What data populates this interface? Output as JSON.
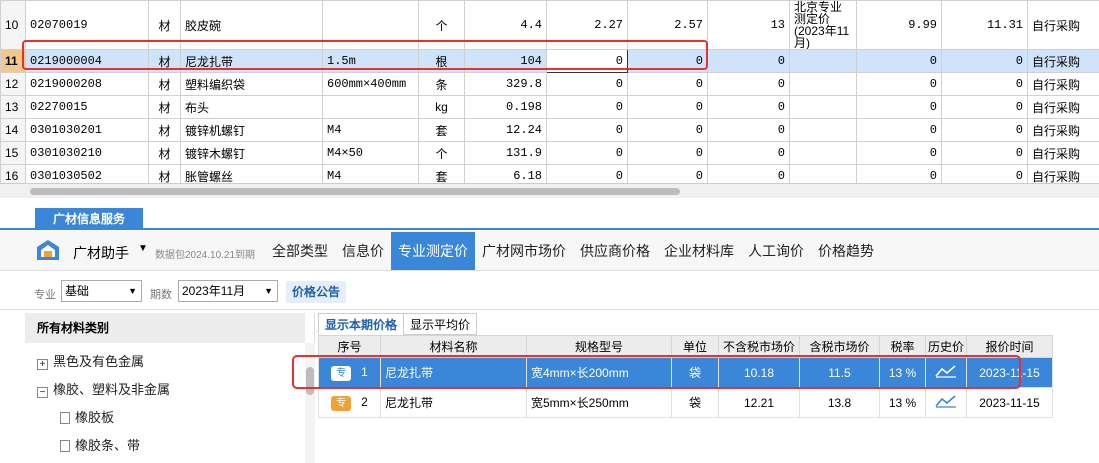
{
  "top_rows": [
    {
      "row": "10",
      "code": "02070019",
      "type": "材",
      "name": "胶皮碗",
      "spec": "",
      "unit": "个",
      "qty": "4.4",
      "p1": "2.27",
      "p2": "2.57",
      "p3": "13",
      "note": "北京专业测定价(2023年11月)",
      "p4": "9.99",
      "p5": "11.31",
      "source": "自行采购"
    },
    {
      "row": "11",
      "code": "0219000004",
      "type": "材",
      "name": "尼龙扎带",
      "spec": "1.5m",
      "unit": "根",
      "qty": "104",
      "p1": "0",
      "p2": "0",
      "p3": "0",
      "note": "",
      "p4": "0",
      "p5": "0",
      "source": "自行采购"
    },
    {
      "row": "12",
      "code": "0219000208",
      "type": "材",
      "name": "塑料编织袋",
      "spec": "600mm×400mm",
      "unit": "条",
      "qty": "329.8",
      "p1": "0",
      "p2": "0",
      "p3": "0",
      "note": "",
      "p4": "0",
      "p5": "0",
      "source": "自行采购"
    },
    {
      "row": "13",
      "code": "02270015",
      "type": "材",
      "name": "布头",
      "spec": "",
      "unit": "kg",
      "qty": "0.198",
      "p1": "0",
      "p2": "0",
      "p3": "0",
      "note": "",
      "p4": "0",
      "p5": "0",
      "source": "自行采购"
    },
    {
      "row": "14",
      "code": "0301030201",
      "type": "材",
      "name": "镀锌机螺钉",
      "spec": "M4",
      "unit": "套",
      "qty": "12.24",
      "p1": "0",
      "p2": "0",
      "p3": "0",
      "note": "",
      "p4": "0",
      "p5": "0",
      "source": "自行采购"
    },
    {
      "row": "15",
      "code": "0301030210",
      "type": "材",
      "name": "镀锌木螺钉",
      "spec": "M4×50",
      "unit": "个",
      "qty": "131.9",
      "p1": "0",
      "p2": "0",
      "p3": "0",
      "note": "",
      "p4": "0",
      "p5": "0",
      "source": "自行采购"
    },
    {
      "row": "16",
      "code": "0301030502",
      "type": "材",
      "name": "胀管螺丝",
      "spec": "M4",
      "unit": "套",
      "qty": "6.18",
      "p1": "0",
      "p2": "0",
      "p3": "0",
      "note": "",
      "p4": "0",
      "p5": "0",
      "source": "自行采购"
    }
  ],
  "service_tab": "广材信息服务",
  "assistant": {
    "name": "广材助手",
    "caret": "▼",
    "package_date": "数据包2024.10.21到期"
  },
  "main_tabs": [
    "全部类型",
    "信息价",
    "专业测定价",
    "广材网市场价",
    "供应商价格",
    "企业材料库",
    "人工询价",
    "价格趋势"
  ],
  "filters": {
    "major_label": "专业",
    "major_value": "基础",
    "period_label": "期数",
    "period_value": "2023年11月",
    "price_notice": "价格公告"
  },
  "left": {
    "header": "所有材料类别",
    "items": [
      {
        "icon": "+",
        "label": "黑色及有色金属"
      },
      {
        "icon": "−",
        "label": "橡胶、塑料及非金属"
      },
      {
        "label": "橡胶板"
      },
      {
        "label": "橡胶条、带"
      }
    ]
  },
  "sub_tabs": [
    "显示本期价格",
    "显示平均价"
  ],
  "price_headers": [
    "序号",
    "材料名称",
    "规格型号",
    "单位",
    "不含税市场价",
    "含税市场价",
    "税率",
    "历史价",
    "报价时间"
  ],
  "price_rows": [
    {
      "badge": "专",
      "no": "1",
      "name": "尼龙扎带",
      "spec": "宽4mm×长200mm",
      "unit": "袋",
      "ex_tax": "10.18",
      "inc_tax": "11.5",
      "rate": "13 %",
      "date": "2023-11-15"
    },
    {
      "badge": "专",
      "no": "2",
      "name": "尼龙扎带",
      "spec": "宽5mm×长250mm",
      "unit": "袋",
      "ex_tax": "12.21",
      "inc_tax": "13.8",
      "rate": "13 %",
      "date": "2023-11-15"
    }
  ],
  "colors": {
    "accent": "#3a86d8",
    "highlight": "#e5322d",
    "selected_row": "#cfe4fb"
  }
}
